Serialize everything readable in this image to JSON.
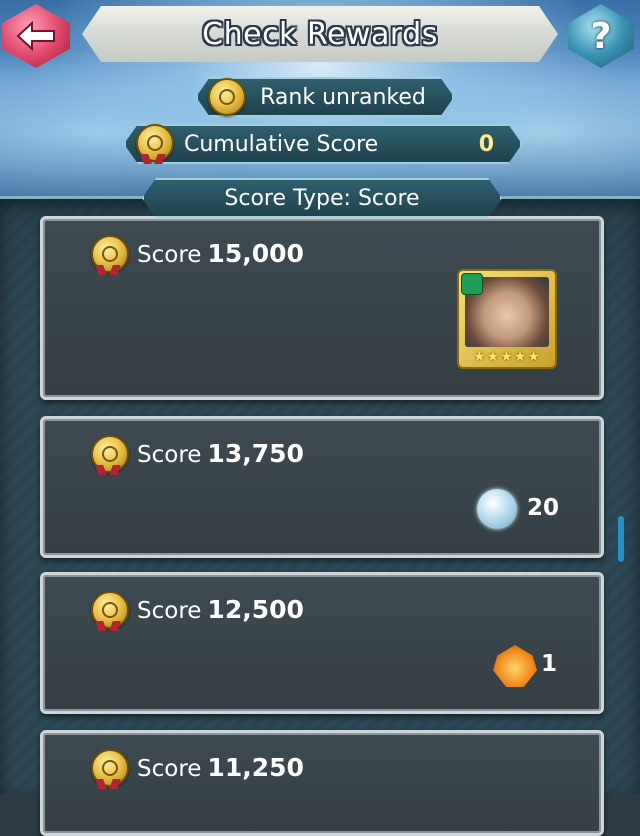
{
  "header": {
    "title": "Check Rewards",
    "back_icon": "arrow-left-icon",
    "help_label": "?"
  },
  "rank": {
    "label": "Rank unranked"
  },
  "cumulative": {
    "label": "Cumulative Score",
    "value": "0"
  },
  "score_type": {
    "label": "Score Type: Score"
  },
  "rewards": [
    {
      "prefix": "Score",
      "score": "15,000",
      "reward_type": "hero",
      "stars": "★★★★★"
    },
    {
      "prefix": "Score",
      "score": "13,750",
      "reward_type": "orb",
      "quantity": "20"
    },
    {
      "prefix": "Score",
      "score": "12,500",
      "reward_type": "crest",
      "quantity": "1"
    },
    {
      "prefix": "Score",
      "score": "11,250"
    }
  ],
  "colors": {
    "accent_gold": "#ffe98a",
    "scroll_accent": "#2a8fc4"
  }
}
